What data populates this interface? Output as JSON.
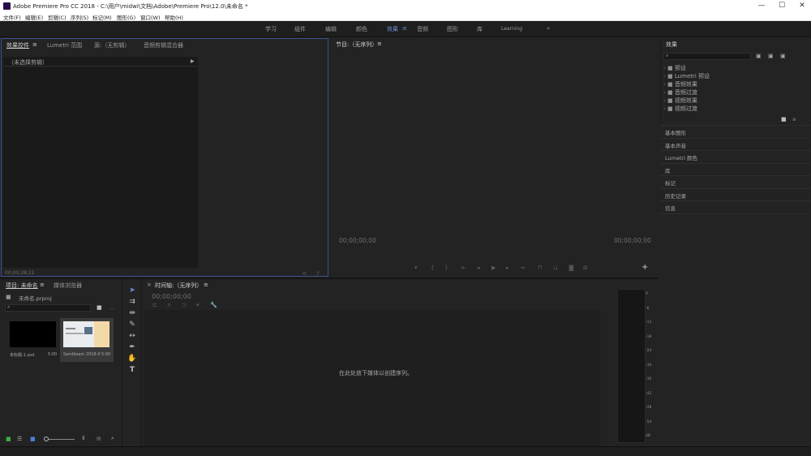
{
  "window": {
    "title": "Adobe Premiere Pro CC 2018 - C:\\用户\\midwi\\文档\\Adobe\\Premiere Pro\\12.0\\未命名 *",
    "controls": {
      "minimize": "—",
      "maximize": "☐",
      "close": "✕"
    }
  },
  "menu": [
    "文件(F)",
    "编辑(E)",
    "剪辑(C)",
    "序列(S)",
    "标记(M)",
    "图形(G)",
    "窗口(W)",
    "帮助(H)"
  ],
  "workspaces": {
    "items": [
      "学习",
      "组件",
      "编辑",
      "颜色",
      "效果",
      "音频",
      "图形",
      "库",
      "Learning"
    ],
    "active": "效果",
    "more": "»"
  },
  "effect_controls": {
    "tabs": [
      "效果控件",
      "Lumetri 范围",
      "源:（无剪辑）",
      "音频剪辑混合器"
    ],
    "no_clip": "（未选择剪辑）",
    "timecode": "00;00;28;21"
  },
  "program": {
    "title": "节目:（无序列）",
    "tc_left": "00;00;00;00",
    "tc_right": "00;00;00;00",
    "add": "+"
  },
  "effects_panel": {
    "title": "效果",
    "folders": [
      "预设",
      "Lumetri 预设",
      "音频效果",
      "音频过渡",
      "视频效果",
      "视频过渡"
    ]
  },
  "side_panels": [
    "基本图形",
    "基本声音",
    "Lumetri 颜色",
    "库",
    "标记",
    "历史记录",
    "信息"
  ],
  "project": {
    "tabs": [
      "项目: 未命名",
      "媒体浏览器"
    ],
    "file": "未命名.prproj",
    "items": [
      {
        "name": "未标题-1.psd",
        "duration": "5:00"
      },
      {
        "name": "Sandbsam 2018-06...",
        "duration": "5:00"
      }
    ]
  },
  "timeline": {
    "title": "时间轴:（无序列）",
    "timecode": "00;00;00;00",
    "drop_hint": "在此处放下媒体以创建序列。"
  },
  "meter": {
    "ticks": [
      "0",
      "-6",
      "-12",
      "-18",
      "-24",
      "-30",
      "-36",
      "-42",
      "-48",
      "-54",
      "dB"
    ]
  },
  "colors": {
    "accent": "#6d8fd8",
    "panel": "#232323",
    "frame": "#3b4f8c"
  }
}
